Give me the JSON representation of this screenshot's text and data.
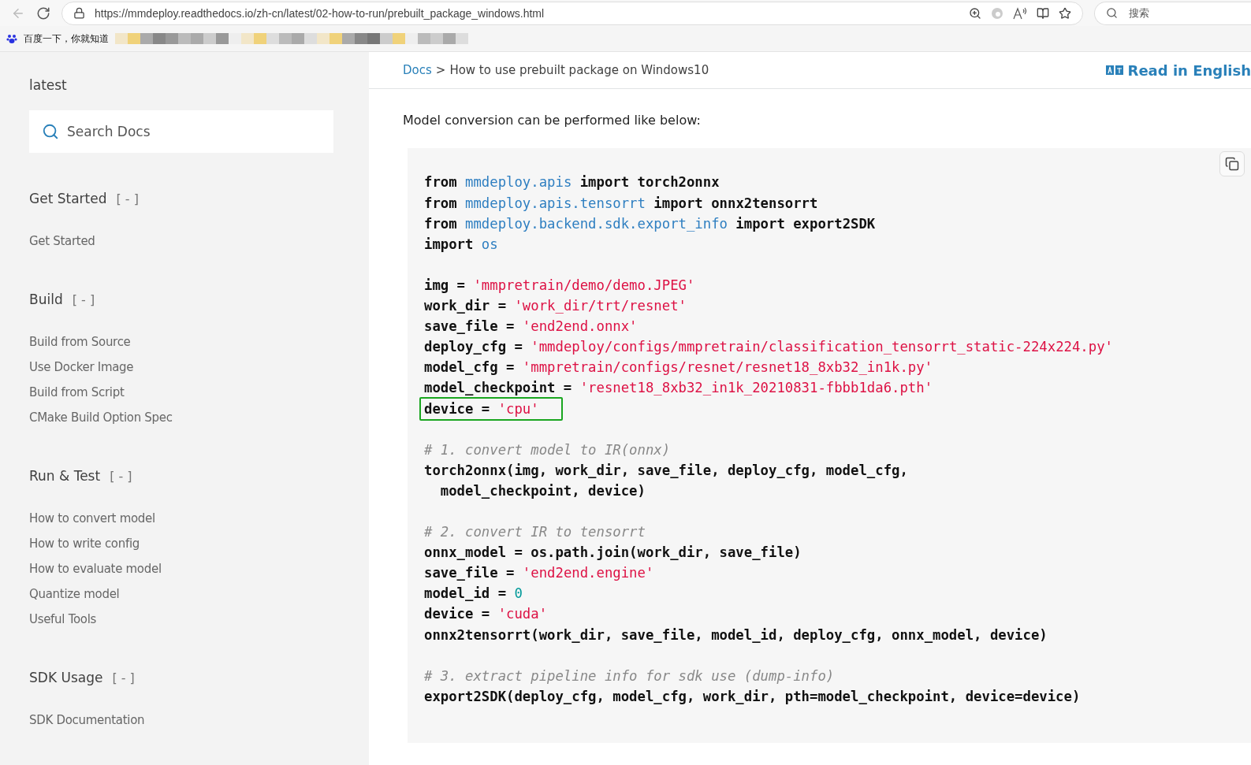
{
  "browser": {
    "url": "https://mmdeploy.readthedocs.io/zh-cn/latest/02-how-to-run/prebuilt_package_windows.html",
    "search_placeholder": "搜索",
    "bookmark": "百度一下，你就知道"
  },
  "sidebar": {
    "version": "latest",
    "search": {
      "placeholder": "Search Docs"
    },
    "sections": [
      {
        "title": "Get Started",
        "toggle": "[ - ]",
        "items": [
          "Get Started"
        ]
      },
      {
        "title": "Build",
        "toggle": "[ - ]",
        "items": [
          "Build from Source",
          "Use Docker Image",
          "Build from Script",
          "CMake Build Option Spec"
        ]
      },
      {
        "title": "Run & Test",
        "toggle": "[ - ]",
        "items": [
          "How to convert model",
          "How to write config",
          "How to evaluate model",
          "Quantize model",
          "Useful Tools"
        ]
      },
      {
        "title": "SDK Usage",
        "toggle": "[ - ]",
        "items": [
          "SDK Documentation"
        ]
      }
    ]
  },
  "breadcrumb": {
    "link": "Docs",
    "separator": ">",
    "current": "How to use prebuilt package on Windows10"
  },
  "language_link": "Read in English",
  "intro": "Model conversion can be performed like below:",
  "code": [
    {
      "lines": [
        {
          "highlighted": false,
          "tokens": [
            {
              "kind": "kw",
              "text": "from "
            },
            {
              "kind": "mod",
              "text": "mmdeploy.apis"
            },
            {
              "kind": "kw",
              "text": " import torch2onnx"
            }
          ]
        },
        {
          "highlighted": false,
          "tokens": [
            {
              "kind": "kw",
              "text": "from "
            },
            {
              "kind": "mod",
              "text": "mmdeploy.apis.tensorrt"
            },
            {
              "kind": "kw",
              "text": " import onnx2tensorrt"
            }
          ]
        },
        {
          "highlighted": false,
          "tokens": [
            {
              "kind": "kw",
              "text": "from "
            },
            {
              "kind": "mod",
              "text": "mmdeploy.backend.sdk.export_info"
            },
            {
              "kind": "kw",
              "text": " import export2SDK"
            }
          ]
        },
        {
          "highlighted": false,
          "tokens": [
            {
              "kind": "kw",
              "text": "import "
            },
            {
              "kind": "mod",
              "text": "os"
            }
          ]
        }
      ]
    },
    {
      "lines": [
        {
          "highlighted": false,
          "tokens": [
            {
              "kind": "kw",
              "text": "img = "
            },
            {
              "kind": "str",
              "text": "'mmpretrain/demo/demo.JPEG'"
            }
          ]
        },
        {
          "highlighted": false,
          "tokens": [
            {
              "kind": "kw",
              "text": "work_dir = "
            },
            {
              "kind": "str",
              "text": "'work_dir/trt/resnet'"
            }
          ]
        },
        {
          "highlighted": false,
          "tokens": [
            {
              "kind": "kw",
              "text": "save_file = "
            },
            {
              "kind": "str",
              "text": "'end2end.onnx'"
            }
          ]
        },
        {
          "highlighted": false,
          "tokens": [
            {
              "kind": "kw",
              "text": "deploy_cfg = "
            },
            {
              "kind": "str",
              "text": "'mmdeploy/configs/mmpretrain/classification_tensorrt_static-224x224.py'"
            }
          ]
        },
        {
          "highlighted": false,
          "tokens": [
            {
              "kind": "kw",
              "text": "model_cfg = "
            },
            {
              "kind": "str",
              "text": "'mmpretrain/configs/resnet/resnet18_8xb32_in1k.py'"
            }
          ]
        },
        {
          "highlighted": false,
          "tokens": [
            {
              "kind": "kw",
              "text": "model_checkpoint = "
            },
            {
              "kind": "str",
              "text": "'resnet18_8xb32_in1k_20210831-fbbb1da6.pth'"
            }
          ]
        },
        {
          "highlighted": true,
          "tokens": [
            {
              "kind": "kw",
              "text": "device = "
            },
            {
              "kind": "str",
              "text": "'cpu'"
            }
          ]
        }
      ]
    },
    {
      "lines": [
        {
          "highlighted": false,
          "tokens": [
            {
              "kind": "comment",
              "text": "# 1. convert model to IR(onnx)"
            }
          ]
        },
        {
          "highlighted": false,
          "tokens": [
            {
              "kind": "kw",
              "text": "torch2onnx(img, work_dir, save_file, deploy_cfg, model_cfg,"
            }
          ]
        },
        {
          "highlighted": false,
          "tokens": [
            {
              "kind": "kw",
              "text": "  model_checkpoint, device)"
            }
          ]
        }
      ]
    },
    {
      "lines": [
        {
          "highlighted": false,
          "tokens": [
            {
              "kind": "comment",
              "text": "# 2. convert IR to tensorrt"
            }
          ]
        },
        {
          "highlighted": false,
          "tokens": [
            {
              "kind": "kw",
              "text": "onnx_model = os.path.join(work_dir, save_file)"
            }
          ]
        },
        {
          "highlighted": false,
          "tokens": [
            {
              "kind": "kw",
              "text": "save_file = "
            },
            {
              "kind": "str",
              "text": "'end2end.engine'"
            }
          ]
        },
        {
          "highlighted": false,
          "tokens": [
            {
              "kind": "kw",
              "text": "model_id = "
            },
            {
              "kind": "num",
              "text": "0"
            }
          ]
        },
        {
          "highlighted": false,
          "tokens": [
            {
              "kind": "kw",
              "text": "device = "
            },
            {
              "kind": "str",
              "text": "'cuda'"
            }
          ]
        },
        {
          "highlighted": false,
          "tokens": [
            {
              "kind": "kw",
              "text": "onnx2tensorrt(work_dir, save_file, model_id, deploy_cfg, onnx_model, device)"
            }
          ]
        }
      ]
    },
    {
      "lines": [
        {
          "highlighted": false,
          "tokens": [
            {
              "kind": "comment",
              "text": "# 3. extract pipeline info for sdk use (dump-info)"
            }
          ]
        },
        {
          "highlighted": false,
          "tokens": [
            {
              "kind": "kw",
              "text": "export2SDK(deploy_cfg, model_cfg, work_dir, pth=model_checkpoint, device=device)"
            }
          ]
        }
      ]
    }
  ]
}
